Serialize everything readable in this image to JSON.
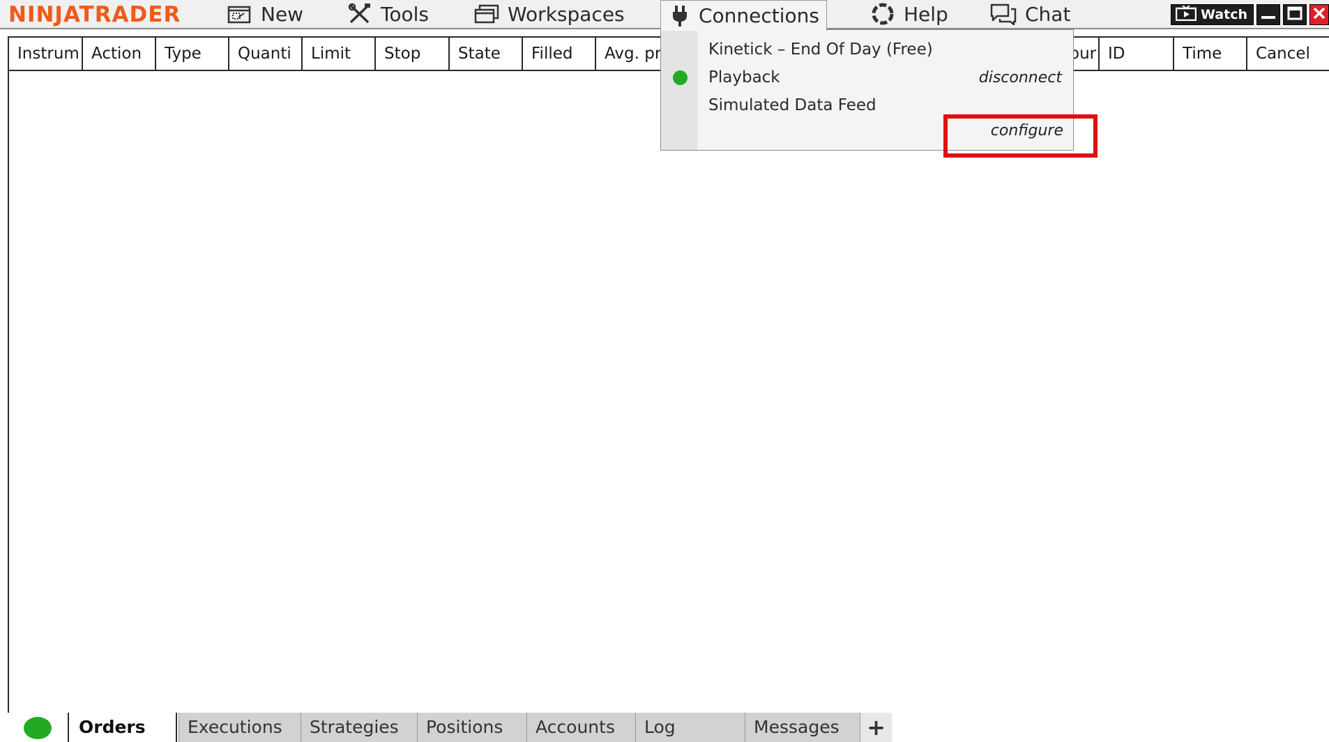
{
  "app": {
    "logo_text": "NINJATRADER"
  },
  "menu": {
    "items": [
      {
        "id": "new",
        "label": "New",
        "icon": "new-window-icon"
      },
      {
        "id": "tools",
        "label": "Tools",
        "icon": "tools-icon"
      },
      {
        "id": "workspaces",
        "label": "Workspaces",
        "icon": "workspaces-icon"
      },
      {
        "id": "connections",
        "label": "Connections",
        "icon": "plug-icon",
        "active": true
      },
      {
        "id": "help",
        "label": "Help",
        "icon": "lifebuoy-icon"
      },
      {
        "id": "chat",
        "label": "Chat",
        "icon": "chat-icon"
      }
    ]
  },
  "window_controls": {
    "watch_label": "Watch",
    "watch_icon": "tv-icon",
    "minimize_icon": "minimize-icon",
    "maximize_icon": "maximize-icon",
    "close_icon": "close-icon"
  },
  "grid": {
    "columns": [
      "Instrum",
      "Action",
      "Type",
      "Quanti",
      "Limit",
      "Stop",
      "State",
      "Filled",
      "Avg. pr",
      "our",
      "ID",
      "Time",
      "Cancel"
    ],
    "rows": []
  },
  "connections_dropdown": {
    "connections": [
      {
        "name": "Kinetick – End Of Day (Free)",
        "connected": false,
        "action": ""
      },
      {
        "name": "Playback",
        "connected": true,
        "action": "disconnect"
      },
      {
        "name": "Simulated Data Feed",
        "connected": false,
        "action": ""
      }
    ],
    "configure_label": "configure"
  },
  "bottom_tabs": {
    "tabs": [
      {
        "label": "Orders",
        "active": true
      },
      {
        "label": "Executions",
        "active": false
      },
      {
        "label": "Strategies",
        "active": false
      },
      {
        "label": "Positions",
        "active": false
      },
      {
        "label": "Accounts",
        "active": false
      },
      {
        "label": "Log",
        "active": false
      },
      {
        "label": "Messages",
        "active": false
      }
    ],
    "add_label": "+"
  },
  "colors": {
    "logo": "#f05a1a",
    "connected": "#22aa22",
    "highlight": "#e01010",
    "close": "#e0202a"
  }
}
